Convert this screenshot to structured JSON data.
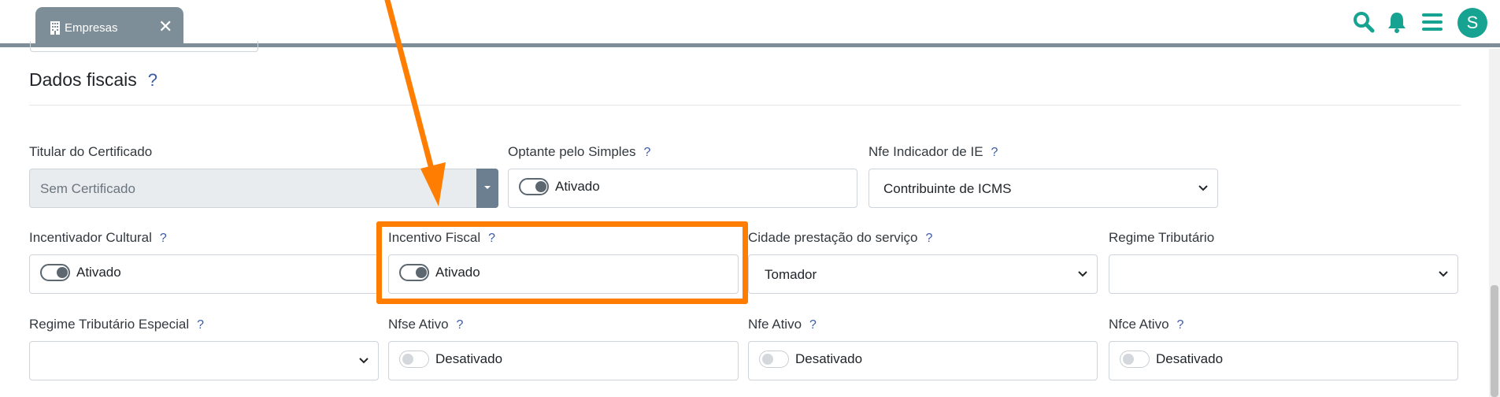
{
  "tab": {
    "label": "Empresas",
    "icon": "building-icon",
    "close": "✕"
  },
  "header": {
    "avatar_initial": "S",
    "icons": [
      "search-icon",
      "bell-icon",
      "menu-icon"
    ],
    "accent": "#17a391"
  },
  "section": {
    "title": "Dados fiscais",
    "help": "?"
  },
  "fields": {
    "titular_certificado": {
      "label": "Titular do Certificado",
      "value": "Sem Certificado"
    },
    "optante_simples": {
      "label": "Optante pelo Simples",
      "help": "?",
      "state": "Ativado"
    },
    "nfe_indicador_ie": {
      "label": "Nfe Indicador de IE",
      "help": "?",
      "value": "Contribuinte de ICMS"
    },
    "incentivador_cultural": {
      "label": "Incentivador Cultural",
      "help": "?",
      "state": "Ativado"
    },
    "incentivo_fiscal": {
      "label": "Incentivo Fiscal",
      "help": "?",
      "state": "Ativado"
    },
    "cidade_prestacao": {
      "label": "Cidade prestação do serviço",
      "help": "?",
      "value": "Tomador"
    },
    "regime_tributario": {
      "label": "Regime Tributário",
      "value": ""
    },
    "regime_tributario_especial": {
      "label": "Regime Tributário Especial",
      "help": "?",
      "value": ""
    },
    "nfse_ativo": {
      "label": "Nfse Ativo",
      "help": "?",
      "state": "Desativado"
    },
    "nfe_ativo": {
      "label": "Nfe Ativo",
      "help": "?",
      "state": "Desativado"
    },
    "nfce_ativo": {
      "label": "Nfce Ativo",
      "help": "?",
      "state": "Desativado"
    }
  },
  "annotation": {
    "color": "#ff7d00"
  }
}
